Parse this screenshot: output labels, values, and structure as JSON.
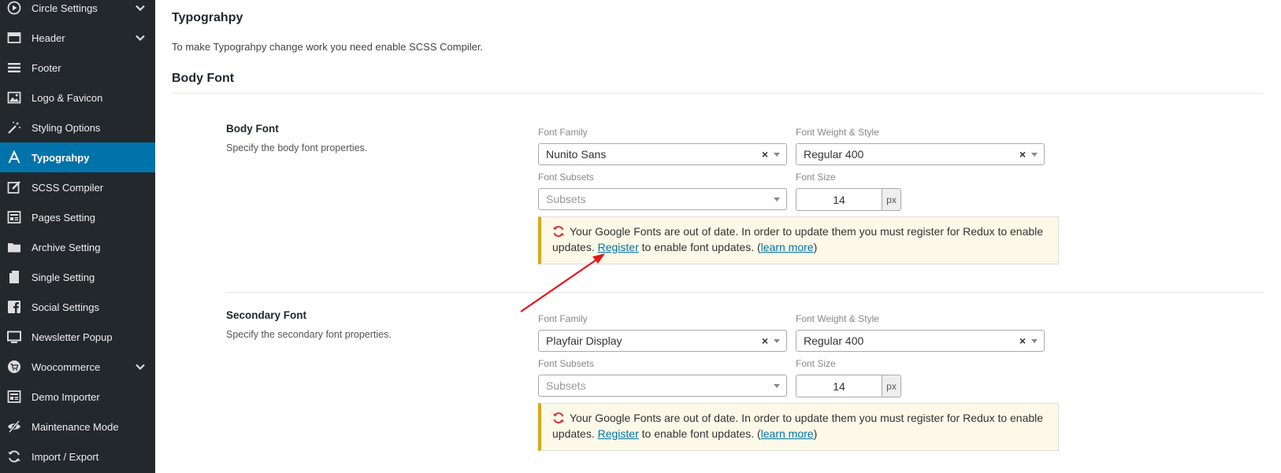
{
  "sidebar": {
    "items": [
      {
        "label": "Circle Settings",
        "icon": "play-circle-icon",
        "chevron": true
      },
      {
        "label": "Header",
        "icon": "header-icon",
        "chevron": true
      },
      {
        "label": "Footer",
        "icon": "menu-icon",
        "chevron": false
      },
      {
        "label": "Logo & Favicon",
        "icon": "image-icon",
        "chevron": false
      },
      {
        "label": "Styling Options",
        "icon": "magic-wand-icon",
        "chevron": false
      },
      {
        "label": "Typograhpy",
        "icon": "font-icon",
        "chevron": false,
        "active": true
      },
      {
        "label": "SCSS Compiler",
        "icon": "edit-icon",
        "chevron": false
      },
      {
        "label": "Pages Setting",
        "icon": "pages-icon",
        "chevron": false
      },
      {
        "label": "Archive Setting",
        "icon": "folder-icon",
        "chevron": false
      },
      {
        "label": "Single Setting",
        "icon": "file-icon",
        "chevron": false
      },
      {
        "label": "Social Settings",
        "icon": "facebook-icon",
        "chevron": false
      },
      {
        "label": "Newsletter Popup",
        "icon": "monitor-icon",
        "chevron": false
      },
      {
        "label": "Woocommerce",
        "icon": "cart-icon",
        "chevron": true
      },
      {
        "label": "Demo Importer",
        "icon": "pages-icon",
        "chevron": false
      },
      {
        "label": "Maintenance Mode",
        "icon": "eye-slash-icon",
        "chevron": false
      },
      {
        "label": "Import / Export",
        "icon": "refresh-icon",
        "chevron": false
      }
    ]
  },
  "main": {
    "title": "Typograhpy",
    "description": "To make Typograhpy change work you need enable SCSS Compiler.",
    "section_title": "Body Font"
  },
  "fonts": [
    {
      "title": "Body Font",
      "subtitle": "Specify the body font properties.",
      "family_label": "Font Family",
      "family_value": "Nunito Sans",
      "weight_label": "Font Weight & Style",
      "weight_value": "Regular 400",
      "subsets_label": "Font Subsets",
      "subsets_placeholder": "Subsets",
      "size_label": "Font Size",
      "size_value": "14",
      "size_unit": "px",
      "notice": {
        "text_before": "Your Google Fonts are out of date. In order to update them you must register for Redux to enable updates.",
        "register_link": "Register",
        "text_middle": "to enable font updates. (",
        "learn_link": "learn more",
        "text_after": ")"
      }
    },
    {
      "title": "Secondary Font",
      "subtitle": "Specify the secondary font properties.",
      "family_label": "Font Family",
      "family_value": "Playfair Display",
      "weight_label": "Font Weight & Style",
      "weight_value": "Regular 400",
      "subsets_label": "Font Subsets",
      "subsets_placeholder": "Subsets",
      "size_label": "Font Size",
      "size_value": "14",
      "size_unit": "px",
      "notice": {
        "text_before": "Your Google Fonts are out of date. In order to update them you must register for Redux to enable updates.",
        "register_link": "Register",
        "text_middle": "to enable font updates. (",
        "learn_link": "learn more",
        "text_after": ")"
      }
    }
  ],
  "colors": {
    "sidebar_bg": "#23282d",
    "active_bg": "#0073aa",
    "link": "#0073aa",
    "notice_border": "#dba617",
    "notice_bg": "#fcf9e8",
    "annotation_arrow": "#e8141a",
    "refresh_icon": "#d63638"
  }
}
